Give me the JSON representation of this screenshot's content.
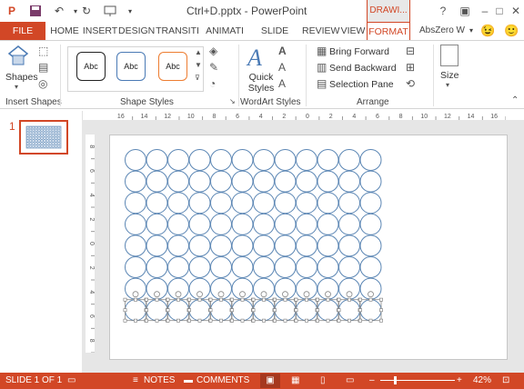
{
  "window": {
    "title": "Ctrl+D.pptx - PowerPoint",
    "context_tab_group": "DRAWI...",
    "qat_icons": [
      "powerpoint-logo-icon",
      "save-icon",
      "undo-icon",
      "redo-icon",
      "slideshow-icon",
      "customize-icon"
    ]
  },
  "tabs": [
    {
      "label": "FILE"
    },
    {
      "label": "HOME"
    },
    {
      "label": "INSERT"
    },
    {
      "label": "DESIGN"
    },
    {
      "label": "TRANSITI"
    },
    {
      "label": "ANIMATI"
    },
    {
      "label": "SLIDE SHO"
    },
    {
      "label": "REVIEW"
    },
    {
      "label": "VIEW"
    },
    {
      "label": "FORMAT"
    }
  ],
  "account": "AbsZero W",
  "ribbon": {
    "groups": {
      "insert_shapes": "Insert Shapes",
      "shape_styles": "Shape Styles",
      "wordart_styles": "WordArt Styles",
      "arrange": "Arrange"
    },
    "shapes_label": "Shapes",
    "style_swatch_label": "Abc",
    "quick_styles_label": "Quick\nStyles",
    "bring_forward": "Bring Forward",
    "send_backward": "Send Backward",
    "selection_pane": "Selection Pane",
    "size_label": "Size"
  },
  "ruler": {
    "h_ticks": [
      "16",
      "14",
      "12",
      "10",
      "8",
      "6",
      "4",
      "2",
      "0",
      "2",
      "4",
      "6",
      "8",
      "10",
      "12",
      "14",
      "16"
    ],
    "v_ticks": [
      "8",
      "6",
      "4",
      "2",
      "0",
      "2",
      "4",
      "6",
      "8"
    ]
  },
  "slide_panel": {
    "slide_number": "1"
  },
  "statusbar": {
    "slide_info": "SLIDE 1 OF 1",
    "notes": "NOTES",
    "comments": "COMMENTS",
    "zoom": "42%",
    "zoom_fraction": 0.42
  },
  "colors": {
    "accent": "#d24726",
    "circle": "#5b86b4",
    "selection": "#888888"
  }
}
